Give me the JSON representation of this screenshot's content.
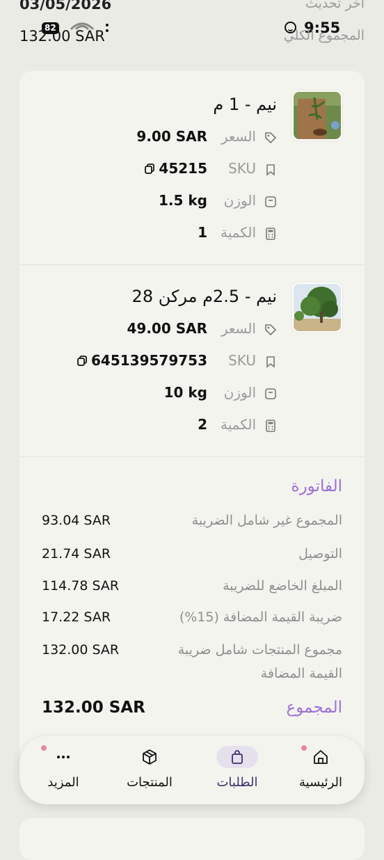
{
  "status_bar": {
    "date": "03/05/2026",
    "last_updated_label": "اخر تحديث",
    "time": "9:55",
    "battery": "82",
    "total_value": "132.00 SAR",
    "total_label": "المجموع الكلي"
  },
  "products": [
    {
      "title": "نيم - 1 م",
      "price_label": "السعر",
      "price": "9.00 SAR",
      "sku_label": "SKU",
      "sku": "45215",
      "weight_label": "الوزن",
      "weight": "1.5 kg",
      "qty_label": "الكمية",
      "qty": "1",
      "thumb_icon": "plant-seedling-photo"
    },
    {
      "title": "نيم - 2.5م مركن 28",
      "price_label": "السعر",
      "price": "49.00 SAR",
      "sku_label": "SKU",
      "sku": "645139579753",
      "weight_label": "الوزن",
      "weight": "10 kg",
      "qty_label": "الكمية",
      "qty": "2",
      "thumb_icon": "tree-photo"
    }
  ],
  "invoice": {
    "title": "الفاتورة",
    "rows": [
      {
        "label": "المجموع غير شامل الضريبة",
        "value": "93.04 SAR"
      },
      {
        "label": "التوصيل",
        "value": "21.74 SAR"
      },
      {
        "label": "المبلغ الخاضع للضريبة",
        "value": "114.78 SAR"
      },
      {
        "label": "ضريبة القيمة المضافة (15%)",
        "value": "17.22 SAR"
      },
      {
        "label": "مجموع المنتجات شامل ضريبة القيمة المضافة",
        "value": "132.00 SAR"
      }
    ],
    "total_label": "المجموع",
    "total_value": "132.00 SAR"
  },
  "nav": {
    "home": "الرئيسية",
    "orders": "الطلبات",
    "products": "المنتجات",
    "more": "المزيد",
    "active": "orders"
  },
  "colors": {
    "accent": "#9c6fd6",
    "background": "#ebebe5",
    "card": "#f4f4ef",
    "badge_dot": "#e8879f"
  }
}
